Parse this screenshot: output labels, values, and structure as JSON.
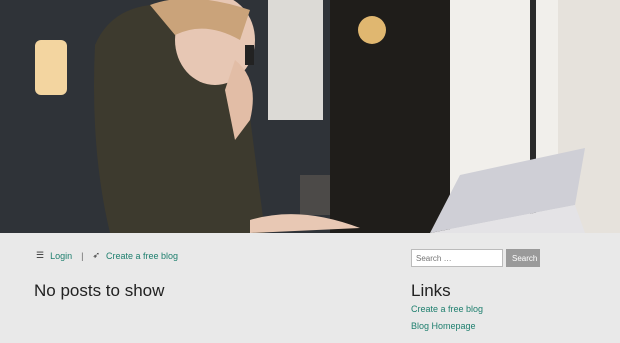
{
  "meta": {
    "login_label": "Login",
    "separator": "|",
    "create_blog_label": "Create a free blog"
  },
  "main": {
    "title": "No posts to show"
  },
  "sidebar": {
    "search": {
      "placeholder": "Search …",
      "button_label": "Search"
    },
    "links_title": "Links",
    "links": [
      {
        "label": "Create a free blog"
      },
      {
        "label": "Blog Homepage"
      }
    ]
  },
  "colors": {
    "link": "#1e7f6e",
    "background": "#e9e9e9"
  }
}
